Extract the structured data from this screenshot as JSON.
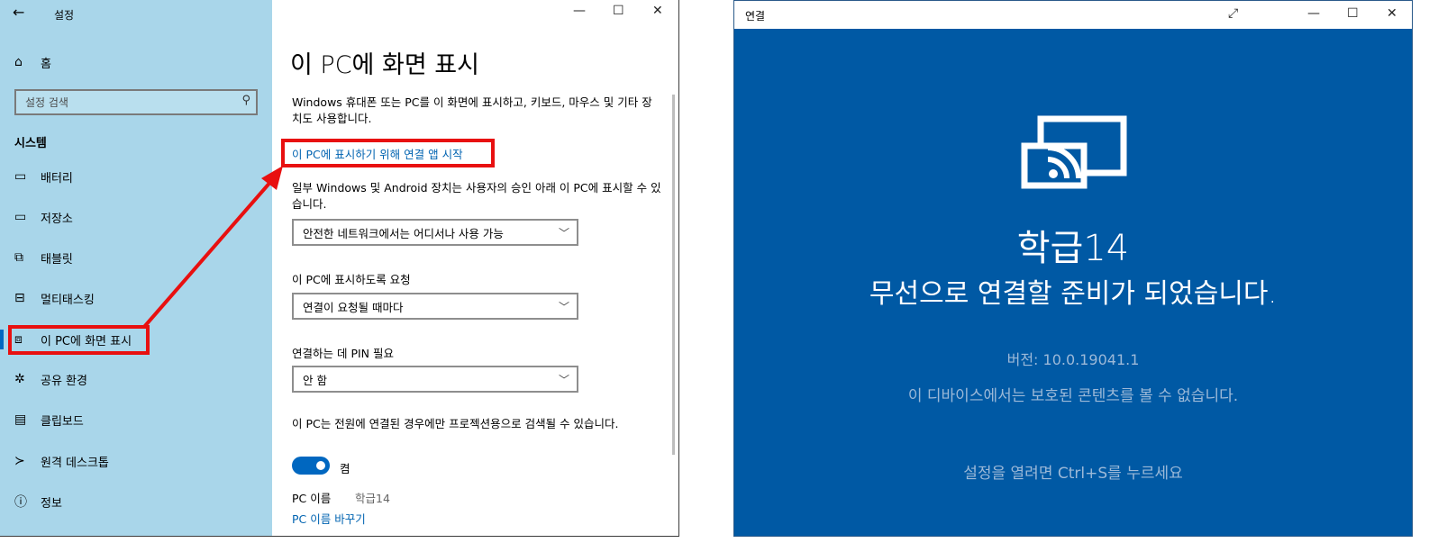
{
  "settings": {
    "window_title": "설정",
    "back_icon": "arrow-left-icon",
    "controls": {
      "minimize": "—",
      "maximize": "☐",
      "close": "✕"
    },
    "home_label": "홈",
    "search_placeholder": "설정 검색",
    "section_heading": "시스템",
    "nav": [
      {
        "label": "배터리",
        "icon": "battery-icon"
      },
      {
        "label": "저장소",
        "icon": "storage-icon"
      },
      {
        "label": "태블릿",
        "icon": "tablet-icon"
      },
      {
        "label": "멀티태스킹",
        "icon": "multitasking-icon"
      },
      {
        "label": "이 PC에 화면 표시",
        "icon": "project-icon",
        "active": true
      },
      {
        "label": "공유 환경",
        "icon": "share-icon"
      },
      {
        "label": "클립보드",
        "icon": "clipboard-icon"
      },
      {
        "label": "원격 데스크톱",
        "icon": "remote-desktop-icon"
      },
      {
        "label": "정보",
        "icon": "info-icon"
      }
    ],
    "page": {
      "title": "이 PC에 화면 표시",
      "description": "Windows 휴대폰 또는 PC를 이 화면에 표시하고, 키보드, 마우스 및 기타 장치도 사용합니다.",
      "launch_link": "이 PC에 표시하기 위해 연결 앱 시작",
      "availability_text": "일부 Windows 및 Android 장치는 사용자의 승인 아래 이 PC에 표시할 수 있습니다.",
      "availability_value": "안전한 네트워크에서는 어디서나 사용 가능",
      "request_label": "이 PC에 표시하도록 요청",
      "request_value": "연결이 요청될 때마다",
      "pin_label": "연결하는 데 PIN 필요",
      "pin_value": "안 함",
      "power_text": "이 PC는 전원에 연결된 경우에만 프로젝션용으로 검색될 수 있습니다.",
      "toggle_state": "켬",
      "pc_name_label": "PC 이름",
      "pc_name_value": "학급14",
      "rename_link": "PC 이름 바꾸기"
    }
  },
  "connect": {
    "window_title": "연결",
    "controls": {
      "expand": "⤢",
      "minimize": "—",
      "maximize": "☐",
      "close": "✕"
    },
    "device_name": "학급14",
    "ready_message": "무선으로 연결할 준비가 되었습니다.",
    "version": "버전: 10.0.19041.1",
    "protected_notice": "이 디바이스에서는 보호된 콘텐츠를 볼 수 없습니다.",
    "settings_hint": "설정을 열려면 Ctrl+S를 누르세요"
  },
  "colors": {
    "sidebar": "#a9d6ea",
    "accent": "#0067c0",
    "link": "#0063b1",
    "connect_bg": "#0059a4",
    "highlight": "#e81010"
  }
}
